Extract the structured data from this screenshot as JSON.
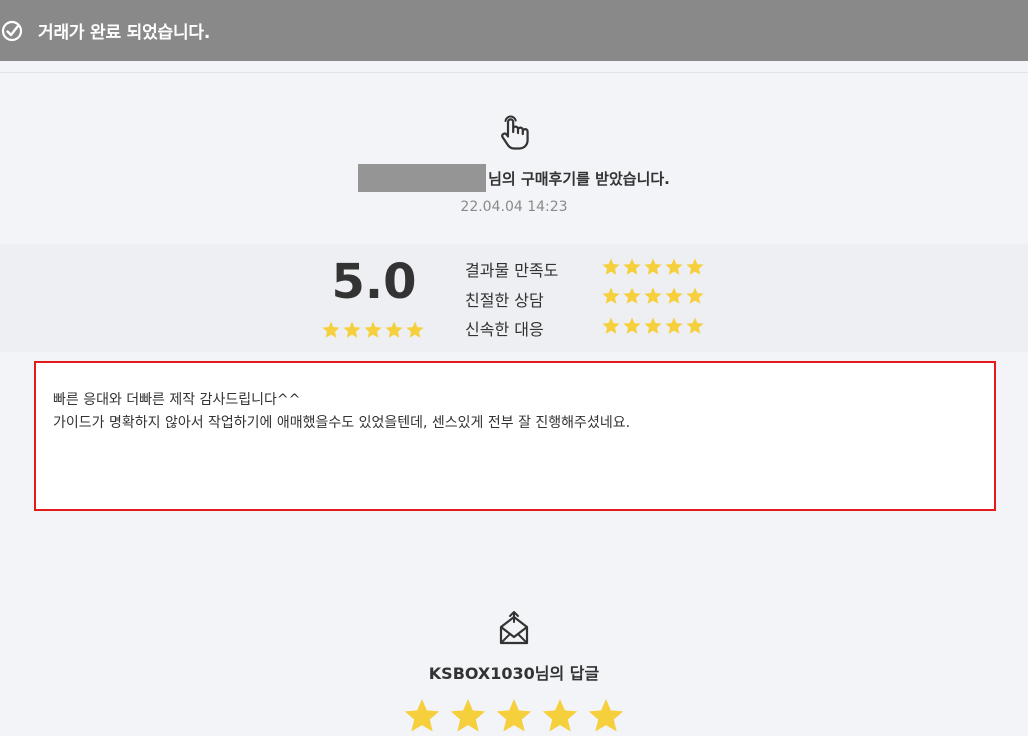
{
  "banner": {
    "title": "거래가 완료 되었습니다.",
    "icon": "check-circle-icon"
  },
  "review": {
    "icon": "hand-pointer-icon",
    "header_suffix": "님의 구매후기를 받았습니다.",
    "date": "22.04.04 14:23",
    "score_display": "5.0",
    "score_stars": 5,
    "categories": [
      {
        "label": "결과물 만족도",
        "stars": 5
      },
      {
        "label": "친절한 상담",
        "stars": 5
      },
      {
        "label": "신속한 대응",
        "stars": 5
      }
    ],
    "comment_lines": [
      "빠른 응대와 더빠른 제작 감사드립니다^^",
      "가이드가 명확하지 않아서 작업하기에 애매했을수도 있었을텐데, 센스있게 전부 잘 진행해주셨네요."
    ]
  },
  "reply": {
    "icon": "envelope-icon",
    "title": "KSBOX1030님의 답글",
    "stars": 5
  },
  "colors": {
    "banner_bg": "#898989",
    "page_bg": "#f3f4f8",
    "star": "#f5cf3c",
    "highlight_border": "#e51b1b"
  }
}
